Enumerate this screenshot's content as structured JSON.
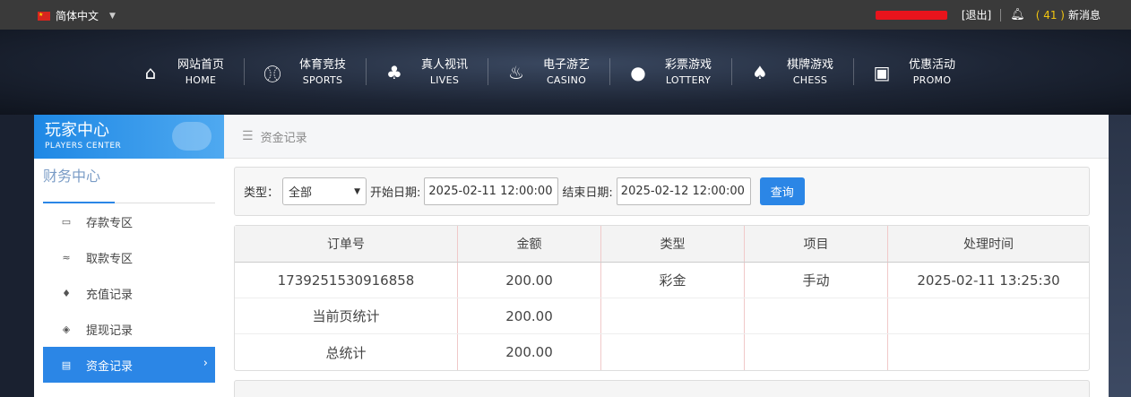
{
  "topbar": {
    "language": "简体中文",
    "logout": "[退出]",
    "message_count": "( 41 )",
    "message_label": "新消息"
  },
  "nav": [
    {
      "cn": "网站首页",
      "en": "HOME",
      "icon": "home-icon"
    },
    {
      "cn": "体育竞技",
      "en": "SPORTS",
      "icon": "ball-icon"
    },
    {
      "cn": "真人视讯",
      "en": "LIVES",
      "icon": "cards-icon"
    },
    {
      "cn": "电子游艺",
      "en": "CASINO",
      "icon": "slot-icon"
    },
    {
      "cn": "彩票游戏",
      "en": "LOTTERY",
      "icon": "lottery-balls-icon"
    },
    {
      "cn": "棋牌游戏",
      "en": "CHESS",
      "icon": "spade-icon"
    },
    {
      "cn": "优惠活动",
      "en": "PROMO",
      "icon": "gift-icon"
    }
  ],
  "sidebar": {
    "title": "玩家中心",
    "subtitle": "PLAYERS CENTER",
    "section": "财务中心",
    "items": [
      {
        "label": "存款专区",
        "icon": "deposit-card-icon"
      },
      {
        "label": "取款专区",
        "icon": "withdraw-cash-icon"
      },
      {
        "label": "充值记录",
        "icon": "money-bag-icon"
      },
      {
        "label": "提现记录",
        "icon": "tag-icon"
      },
      {
        "label": "资金记录",
        "icon": "ledger-icon",
        "active": true
      }
    ]
  },
  "main": {
    "breadcrumb": "资金记录",
    "filter": {
      "type_label": "类型：",
      "type_value": "全部",
      "start_label": "开始日期:",
      "start_value": "2025-02-11 12:00:00",
      "end_label": "结束日期:",
      "end_value": "2025-02-12 12:00:00",
      "query_button": "查询"
    },
    "table": {
      "headers": [
        "订单号",
        "金额",
        "类型",
        "项目",
        "处理时间"
      ],
      "rows": [
        [
          "1739251530916858",
          "200.00",
          "彩金",
          "手动",
          "2025-02-11 13:25:30"
        ],
        [
          "当前页统计",
          "200.00",
          "",
          "",
          ""
        ],
        [
          "总统计",
          "200.00",
          "",
          "",
          ""
        ]
      ]
    }
  },
  "colors": {
    "accent": "#2b86e6",
    "message_count": "#f1c40f",
    "redaction": "#e8141c"
  }
}
